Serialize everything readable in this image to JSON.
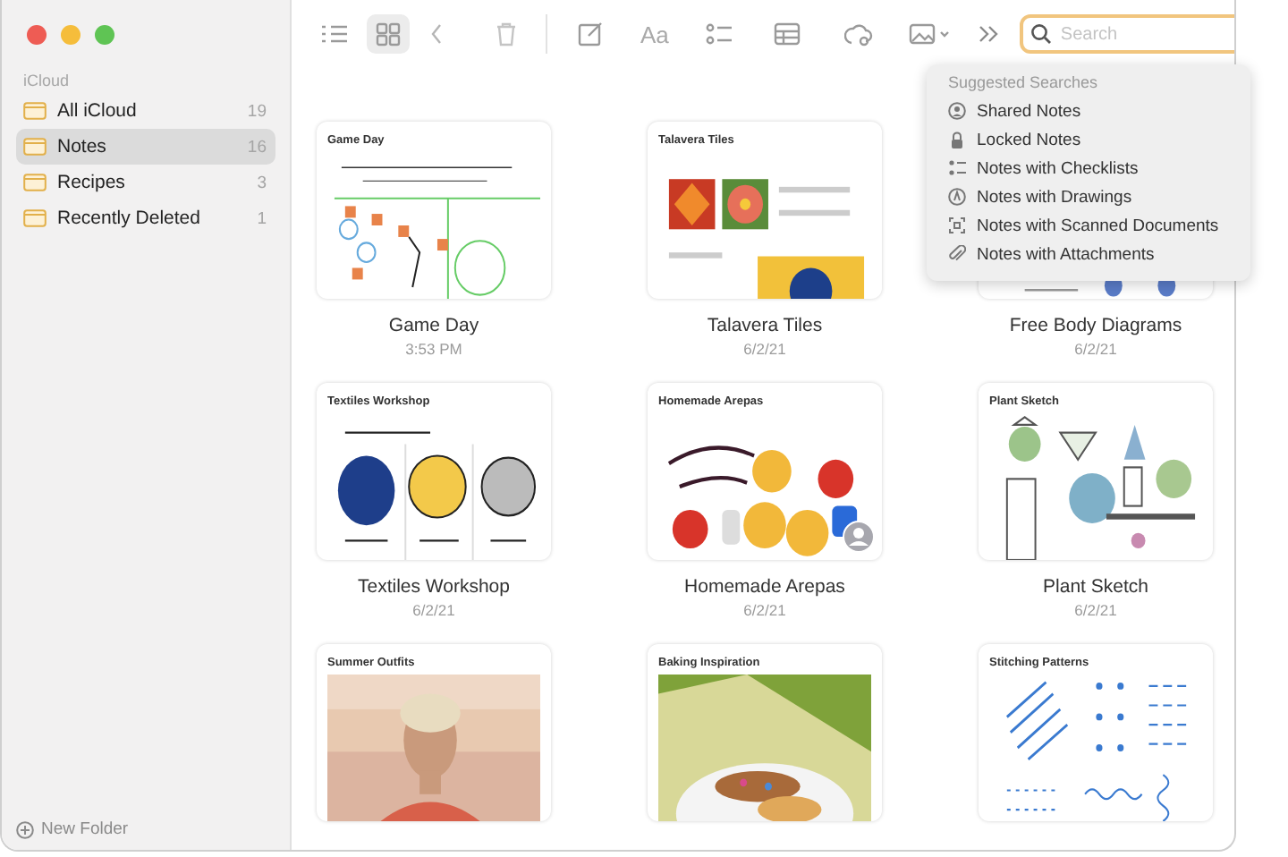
{
  "sidebar": {
    "section": "iCloud",
    "folders": [
      {
        "name": "All iCloud",
        "count": "19",
        "selected": false
      },
      {
        "name": "Notes",
        "count": "16",
        "selected": true
      },
      {
        "name": "Recipes",
        "count": "3",
        "selected": false
      },
      {
        "name": "Recently Deleted",
        "count": "1",
        "selected": false
      }
    ],
    "new_folder": "New Folder"
  },
  "toolbar": {
    "view_modes": [
      {
        "kind": "list",
        "selected": false
      },
      {
        "kind": "gallery",
        "selected": true
      }
    ],
    "format_label": "Aa"
  },
  "search": {
    "placeholder": "Search"
  },
  "suggestions": {
    "header": "Suggested Searches",
    "items": [
      {
        "kind": "shared",
        "label": "Shared Notes"
      },
      {
        "kind": "locked",
        "label": "Locked Notes"
      },
      {
        "kind": "checklist",
        "label": "Notes with Checklists"
      },
      {
        "kind": "drawing",
        "label": "Notes with Drawings"
      },
      {
        "kind": "scan",
        "label": "Notes with Scanned Documents"
      },
      {
        "kind": "attachment",
        "label": "Notes with Attachments"
      }
    ]
  },
  "notes": [
    {
      "thumb_title": "Game Day",
      "title": "Game Day",
      "date": "3:53 PM"
    },
    {
      "thumb_title": "Talavera Tiles",
      "title": "Talavera Tiles",
      "date": "6/2/21"
    },
    {
      "title": "Free Body Diagrams",
      "date": "6/2/21"
    },
    {
      "thumb_title": "Textiles Workshop",
      "title": "Textiles Workshop",
      "date": "6/2/21"
    },
    {
      "thumb_title": "Homemade Arepas",
      "shared": true,
      "title": "Homemade Arepas",
      "date": "6/2/21"
    },
    {
      "thumb_title": "Plant Sketch",
      "title": "Plant Sketch",
      "date": "6/2/21"
    },
    {
      "thumb_title": "Summer Outfits"
    },
    {
      "thumb_title": "Baking Inspiration"
    },
    {
      "thumb_title": "Stitching Patterns"
    }
  ]
}
